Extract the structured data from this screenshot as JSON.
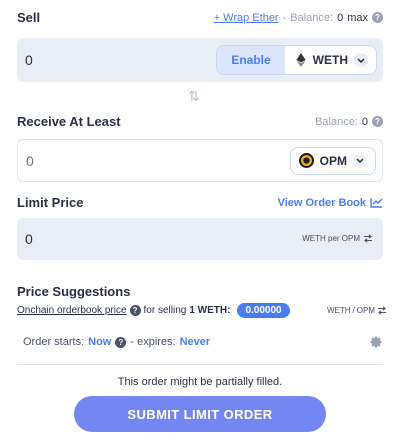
{
  "sell": {
    "label": "Sell",
    "wrap_link": "+ Wrap Ether",
    "separator": "-",
    "balance_label": "Balance:",
    "balance_value": "0",
    "max_label": "max",
    "amount": "0",
    "enable_label": "Enable",
    "token": "WETH"
  },
  "receive": {
    "label": "Receive At Least",
    "balance_label": "Balance:",
    "balance_value": "0",
    "amount": "0",
    "token": "OPM"
  },
  "limit_price": {
    "label": "Limit Price",
    "view_order_book": "View Order Book",
    "amount": "0",
    "pair_label": "WETH per OPM"
  },
  "price_suggestions": {
    "label": "Price Suggestions",
    "source_link": "Onchain orderbook price",
    "for_selling": "for selling",
    "selling_amount": "1 WETH:",
    "suggested_value": "0.00000",
    "pair_base": "WETH",
    "pair_sep": "/",
    "pair_quote": "OPM"
  },
  "order_timing": {
    "starts_label": "Order starts:",
    "starts_value": "Now",
    "expires_label": "- expires:",
    "expires_value": "Never"
  },
  "notice": "This order might be partially filled.",
  "submit_label": "SUBMIT LIMIT ORDER",
  "colors": {
    "accent": "#4a7cf0",
    "submit": "#7486f2",
    "panel": "#e9edf5"
  }
}
